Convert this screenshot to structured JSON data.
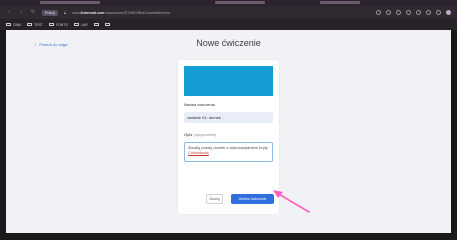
{
  "browser": {
    "site_chip": "Pracuj",
    "url_prefix": "www.",
    "url_host": "tinkercad.com",
    "url_path": "/classrooms/3TGM6YBfuEJr/activities/new",
    "bookmarks": [
      "CNM",
      "TEST",
      "FONTS",
      "LAR",
      "",
      ""
    ]
  },
  "page": {
    "back_label": "Powrót do zajęć",
    "title": "Nowe ćwiczenie"
  },
  "form": {
    "banner_color": "#149ed4",
    "name_label": "Nazwa ćwiczenia",
    "name_value": "zadanie 01: domek",
    "desc_label": "Opis",
    "desc_optional": "(opcjonalnie)",
    "desc_text": "Zbuduj prosty domek z wykorzystaniem bryły ",
    "desc_link": "Codeblocks",
    "cancel_label": "Anuluj",
    "create_label": "Utwórz ćwiczenie"
  },
  "colors": {
    "accent": "#2f6fdd",
    "annotation_arrow": "#ff5fc2"
  }
}
